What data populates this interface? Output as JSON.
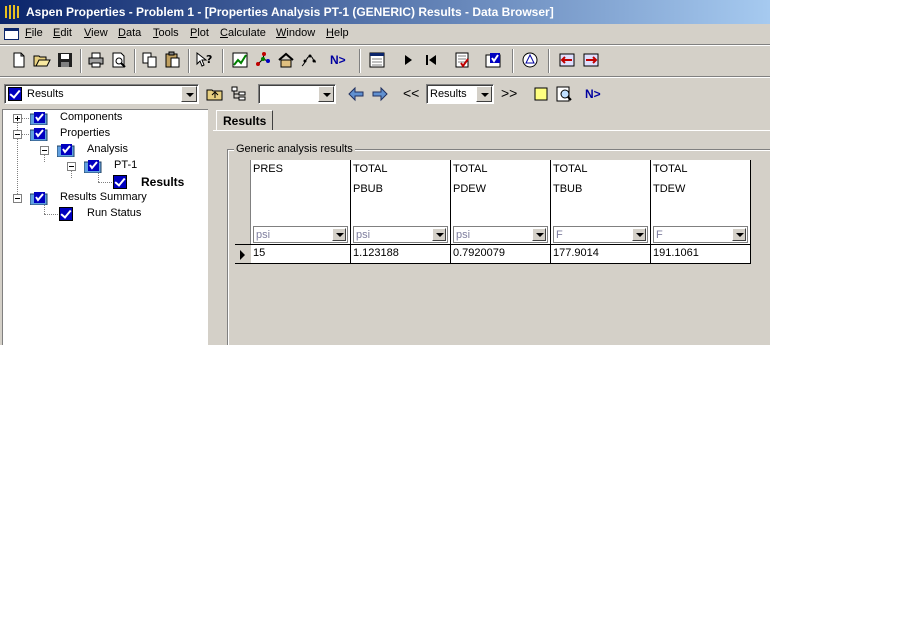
{
  "window": {
    "title": "Aspen Properties - Problem 1 - [Properties Analysis PT-1 (GENERIC) Results - Data Browser]"
  },
  "menu": [
    {
      "label": "File",
      "u": "F",
      "rest": "ile"
    },
    {
      "label": "Edit",
      "u": "E",
      "rest": "dit"
    },
    {
      "label": "View",
      "u": "V",
      "rest": "iew"
    },
    {
      "label": "Data",
      "u": "D",
      "rest": "ata"
    },
    {
      "label": "Tools",
      "u": "T",
      "rest": "ools"
    },
    {
      "label": "Plot",
      "u": "P",
      "rest": "lot"
    },
    {
      "label": "Calculate",
      "u": "C",
      "rest": "alculate"
    },
    {
      "label": "Window",
      "u": "W",
      "rest": "indow"
    },
    {
      "label": "Help",
      "u": "H",
      "rest": "elp"
    }
  ],
  "toolbar": {
    "next_label": "N>"
  },
  "navbar": {
    "form_selector": "Results",
    "sheet_selector": "",
    "prev_label": "<<",
    "results_selector": "Results",
    "next_label": ">>",
    "n_next_label": "N>"
  },
  "tree": {
    "components": "Components",
    "properties": "Properties",
    "analysis": "Analysis",
    "pt1": "PT-1",
    "results": "Results",
    "results_summary": "Results Summary",
    "run_status": "Run Status"
  },
  "content": {
    "tab": "Results",
    "group_title": "Generic analysis results",
    "columns": [
      {
        "h1": "PRES",
        "h2": "",
        "unit": "psi",
        "value": "15"
      },
      {
        "h1": "TOTAL",
        "h2": "PBUB",
        "unit": "psi",
        "value": "1.123188"
      },
      {
        "h1": "TOTAL",
        "h2": "PDEW",
        "unit": "psi",
        "value": "0.7920079"
      },
      {
        "h1": "TOTAL",
        "h2": "TBUB",
        "unit": "F",
        "value": "177.9014"
      },
      {
        "h1": "TOTAL",
        "h2": "TDEW",
        "unit": "F",
        "value": "191.1061"
      }
    ]
  }
}
